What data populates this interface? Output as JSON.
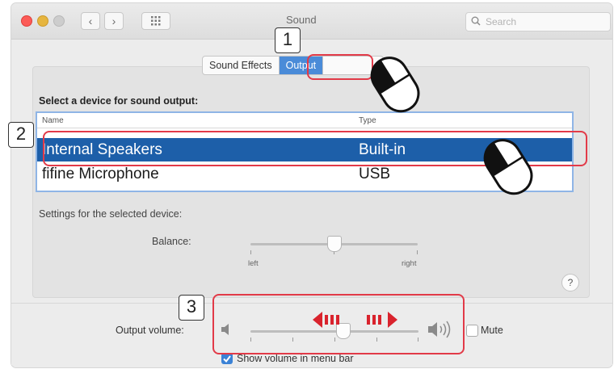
{
  "window": {
    "title": "Sound",
    "search_placeholder": "Search",
    "nav_back": "‹",
    "nav_forward": "›"
  },
  "tabs": [
    {
      "label": "Sound Effects",
      "active": false
    },
    {
      "label": "Output",
      "active": true
    },
    {
      "label": "",
      "active": false
    }
  ],
  "output": {
    "section_label": "Select a device for sound output:",
    "columns": [
      "Name",
      "Type"
    ],
    "devices": [
      {
        "name": "Internal Speakers",
        "type": "Built-in",
        "selected": true
      },
      {
        "name": "fifine Microphone",
        "type": "USB",
        "selected": false
      }
    ],
    "settings_label": "Settings for the selected device:",
    "balance": {
      "label": "Balance:",
      "left_label": "left",
      "right_label": "right",
      "value": 0.5
    },
    "help": "?"
  },
  "volume": {
    "label": "Output volume:",
    "level": 0.55,
    "mute_label": "Mute",
    "muted": false,
    "show_in_menu_bar_label": "Show volume in menu bar",
    "show_in_menu_bar": true
  },
  "annotations": {
    "step1": "1",
    "step2": "2",
    "step3": "3",
    "highlight_color": "#e23a48",
    "arrow_color": "#d9232d"
  }
}
